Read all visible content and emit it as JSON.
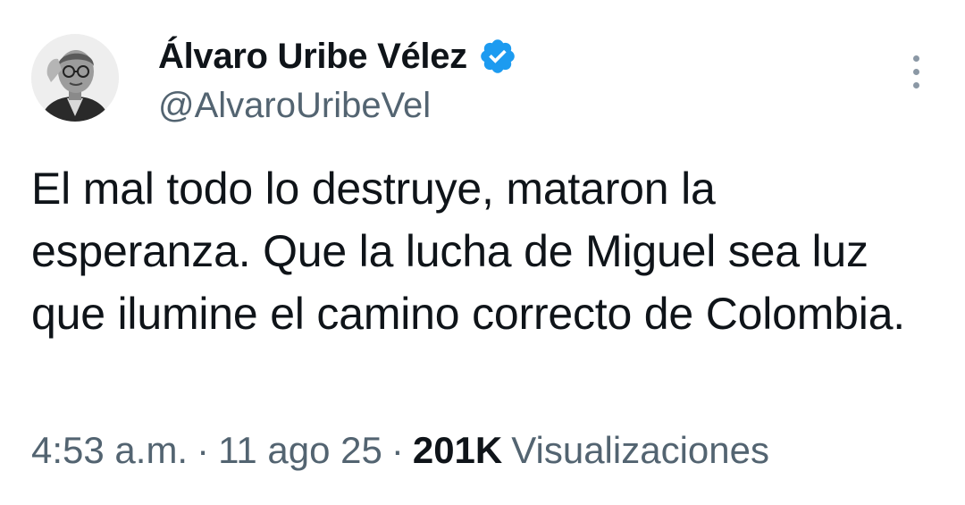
{
  "author": {
    "display_name": "Álvaro Uribe Vélez",
    "handle": "@AlvaroUribeVel",
    "verified": true,
    "verified_color": "#1d9bf0"
  },
  "icons": {
    "avatar": "profile-photo",
    "verified": "verified-badge-icon",
    "more": "more-vertical-icon"
  },
  "tweet": {
    "text": "El mal todo lo destruye, mataron la esperanza. Que la lucha de Miguel sea luz que ilumine el camino correcto de Colombia.",
    "time": "4:53 a.m.",
    "separator": "·",
    "date": "11 ago 25",
    "views_count": "201K",
    "views_label": "Visualizaciones"
  },
  "colors": {
    "primary_text": "#0f1419",
    "secondary_text": "#536471"
  }
}
